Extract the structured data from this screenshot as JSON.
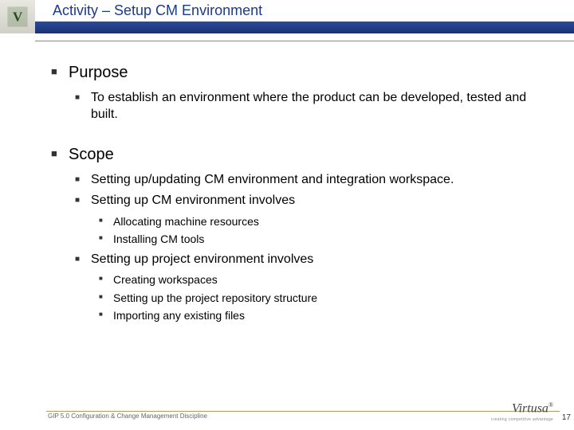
{
  "header": {
    "title": "Activity – Setup CM Environment"
  },
  "sections": {
    "purpose": {
      "label": "Purpose",
      "items": {
        "0": "To establish an environment where the product can be developed, tested and built."
      }
    },
    "scope": {
      "label": "Scope",
      "items": {
        "0": "Setting up/updating CM environment and integration workspace.",
        "1": "Setting up CM environment involves",
        "1_sub": {
          "0": "Allocating machine resources",
          "1": "Installing CM tools"
        },
        "2": "Setting up project environment involves",
        "2_sub": {
          "0": "Creating workspaces",
          "1": "Setting up the project repository structure",
          "2": "Importing any existing files"
        }
      }
    }
  },
  "footer": {
    "text": "GIP 5.0 Configuration & Change Management Discipline",
    "brand": "Virtusa",
    "tagline": "creating competitive advantage",
    "page": "17"
  }
}
